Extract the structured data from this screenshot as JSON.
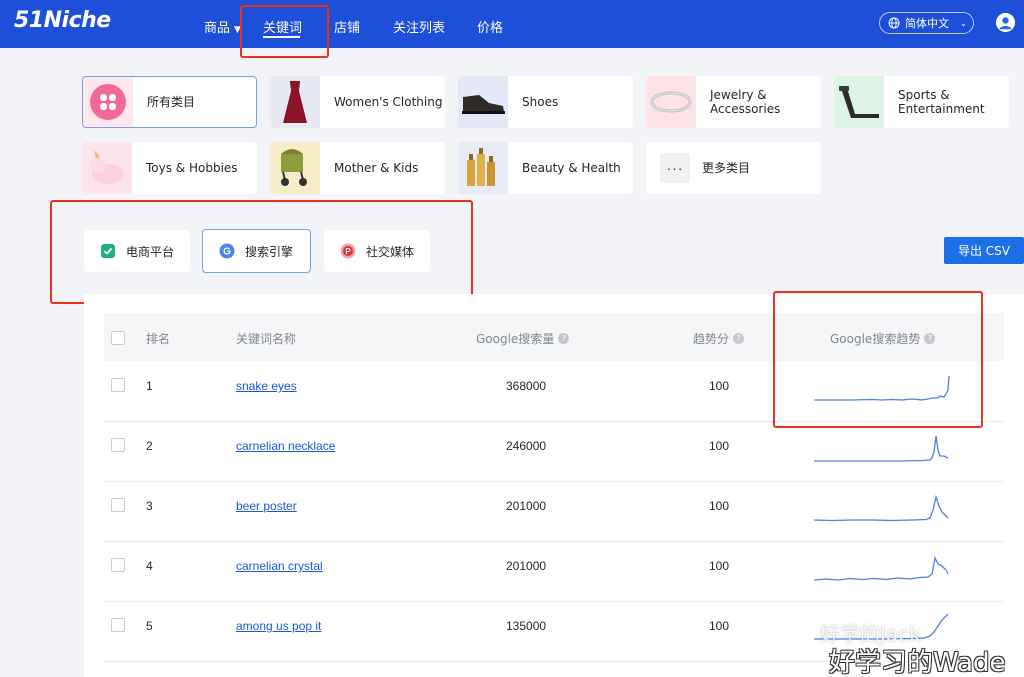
{
  "header": {
    "logo": "51Niche",
    "nav": [
      {
        "label": "商品",
        "has_caret": true
      },
      {
        "label": "关键词"
      },
      {
        "label": "店铺"
      },
      {
        "label": "关注列表"
      },
      {
        "label": "价格"
      }
    ],
    "active_nav": "关键词",
    "language": "简体中文",
    "colors": {
      "bar": "#1d4fd8",
      "accent": "#1d6fe8",
      "highlight_box": "#e8321f",
      "link": "#1a56db"
    }
  },
  "categories": [
    {
      "label": "所有类目",
      "active": true,
      "icon": "grid-icon"
    },
    {
      "label": "Women's Clothing",
      "icon": "dress-icon"
    },
    {
      "label": "Shoes",
      "icon": "shoe-icon"
    },
    {
      "label": "Jewelry & Accessories",
      "icon": "bracelet-icon"
    },
    {
      "label": "Sports & Entertainment",
      "icon": "treadmill-icon"
    },
    {
      "label": "Toys & Hobbies",
      "icon": "unicorn-toy-icon"
    },
    {
      "label": "Mother & Kids",
      "icon": "stroller-icon"
    },
    {
      "label": "Beauty & Health",
      "icon": "cosmetics-icon"
    },
    {
      "label": "更多类目",
      "icon": "more-dots-icon"
    }
  ],
  "filters": [
    {
      "label": "电商平台",
      "icon": "shield-check-icon",
      "active": false
    },
    {
      "label": "搜索引擎",
      "icon": "google-icon",
      "active": true
    },
    {
      "label": "社交媒体",
      "icon": "pinterest-icon",
      "active": false
    }
  ],
  "export_label": "导出 CSV",
  "table": {
    "columns": [
      "排名",
      "关键词名称",
      "Google搜索量",
      "趋势分",
      "Google搜索趋势"
    ],
    "rows": [
      {
        "rank": "1",
        "keyword": "snake eyes",
        "volume": "368000",
        "score": "100"
      },
      {
        "rank": "2",
        "keyword": "carnelian necklace",
        "volume": "246000",
        "score": "100"
      },
      {
        "rank": "3",
        "keyword": "beer poster",
        "volume": "201000",
        "score": "100"
      },
      {
        "rank": "4",
        "keyword": "carnelian crystal",
        "volume": "201000",
        "score": "100"
      },
      {
        "rank": "5",
        "keyword": "among us pop it",
        "volume": "135000",
        "score": "100"
      }
    ]
  },
  "watermark": {
    "small": "好学的Jack",
    "large": "好学习的Wade"
  }
}
